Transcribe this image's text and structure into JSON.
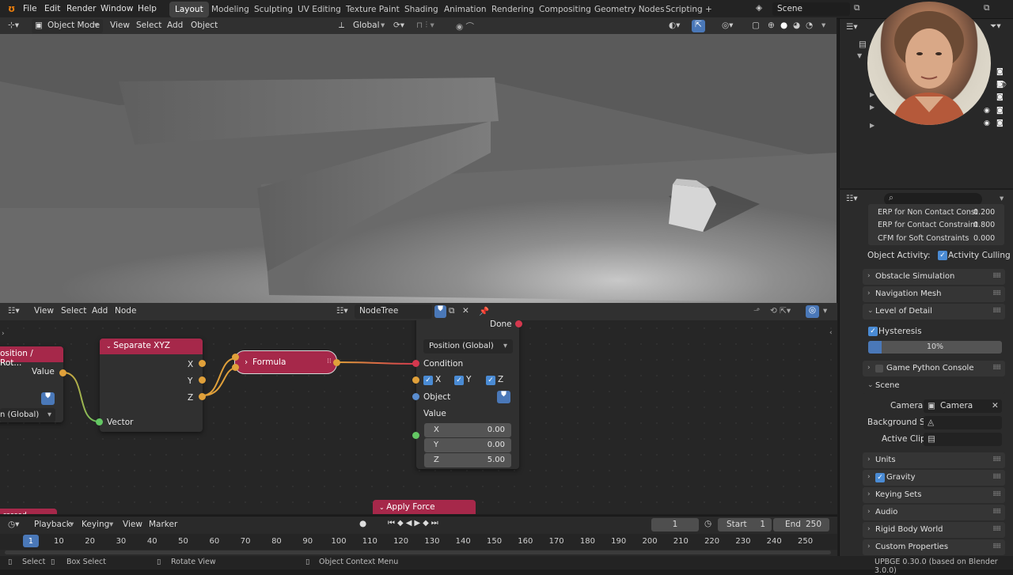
{
  "menu": {
    "items": [
      "File",
      "Edit",
      "Render",
      "Window",
      "Help"
    ]
  },
  "workspaces": [
    "Layout",
    "Modeling",
    "Sculpting",
    "UV Editing",
    "Texture Paint",
    "Shading",
    "Animation",
    "Rendering",
    "Compositing",
    "Geometry Nodes",
    "Scripting",
    "+"
  ],
  "scene": {
    "name": "Scene"
  },
  "viewport_header": {
    "mode": "Object Mode",
    "view": "View",
    "select": "Select",
    "add": "Add",
    "object": "Object",
    "orientation": "Global"
  },
  "node_header": {
    "view": "View",
    "select": "Select",
    "add": "Add",
    "node": "Node",
    "tree": "NodeTree"
  },
  "nodes": {
    "left": {
      "title": "osition / Rot...",
      "value_label": "Value",
      "global_label": "n (Global)"
    },
    "separate": {
      "title": "Separate XYZ",
      "x": "X",
      "y": "Y",
      "z": "Z",
      "vector": "Vector"
    },
    "formula": {
      "title": "Formula"
    },
    "condition": {
      "done": "Done",
      "dropdown": "Position (Global)",
      "condition": "Condition",
      "x": "X",
      "y": "Y",
      "z": "Z",
      "object": "Object",
      "value": "Value",
      "vx_label": "X",
      "vx": "0.00",
      "vy_label": "Y",
      "vy": "0.00",
      "vz_label": "Z",
      "vz": "5.00"
    },
    "apply_force": {
      "title": "Apply Force"
    },
    "bottom_left": {
      "title": "ressed"
    }
  },
  "timeline": {
    "playback": "Playback",
    "keying": "Keying",
    "view": "View",
    "marker": "Marker",
    "current": "1",
    "start_label": "Start",
    "start": "1",
    "end_label": "End",
    "end": "250",
    "ticks": [
      "1",
      "10",
      "20",
      "30",
      "40",
      "50",
      "60",
      "70",
      "80",
      "90",
      "100",
      "110",
      "120",
      "130",
      "140",
      "150",
      "160",
      "170",
      "180",
      "190",
      "200",
      "210",
      "220",
      "230",
      "240",
      "250"
    ]
  },
  "status": {
    "select": "Select",
    "box_select": "Box Select",
    "rotate": "Rotate View",
    "context": "Object Context Menu",
    "version": "UPBGE 0.30.0 (based on Blender 3.0.0)"
  },
  "properties": {
    "erp_noncontact_label": "ERP for Non Contact Const",
    "erp_noncontact": "0.200",
    "erp_contact_label": "ERP for Contact Constraint",
    "erp_contact": "0.800",
    "cfm_label": "CFM for Soft Constraints",
    "cfm": "0.000",
    "activity_label": "Object Activity:",
    "activity_culling": "Activity Culling",
    "obstacle": "Obstacle Simulation",
    "navmesh": "Navigation Mesh",
    "lod": "Level of Detail",
    "hysteresis": "Hysteresis",
    "hysteresis_value": "10%",
    "python_console": "Game Python Console",
    "scene": "Scene",
    "camera_label": "Camera",
    "camera_value": "Camera",
    "background_label": "Background S...",
    "active_clip_label": "Active Clip",
    "units": "Units",
    "gravity": "Gravity",
    "keying_sets": "Keying Sets",
    "audio": "Audio",
    "rigid_body": "Rigid Body World",
    "custom_props": "Custom Properties"
  },
  "colors": {
    "node_header": "#a6284a",
    "accent": "#4a8bd4",
    "socket_orange": "#e0a03a",
    "socket_red": "#d4384e"
  }
}
